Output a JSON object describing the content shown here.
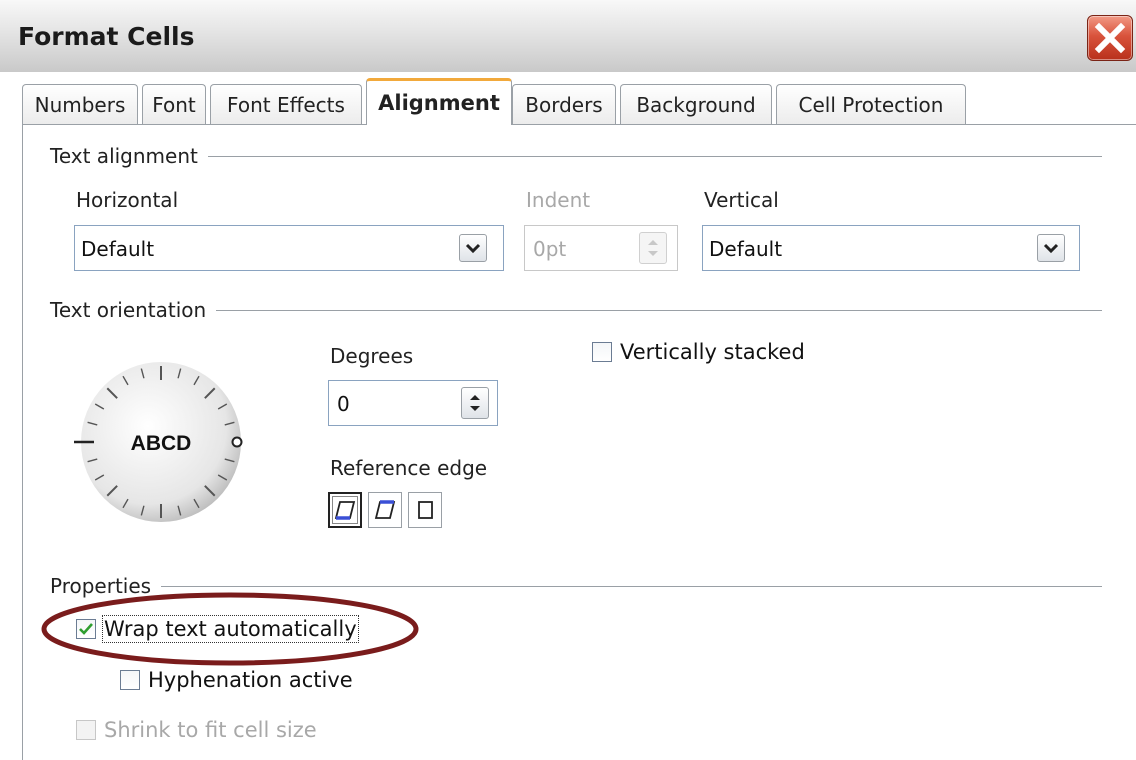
{
  "window": {
    "title": "Format Cells"
  },
  "tabs": [
    {
      "label": "Numbers"
    },
    {
      "label": "Font"
    },
    {
      "label": "Font Effects"
    },
    {
      "label": "Alignment"
    },
    {
      "label": "Borders"
    },
    {
      "label": "Background"
    },
    {
      "label": "Cell Protection"
    }
  ],
  "text_alignment": {
    "section_label": "Text alignment",
    "horizontal": {
      "label": "Horizontal",
      "value": "Default"
    },
    "indent": {
      "label": "Indent",
      "value": "0pt"
    },
    "vertical": {
      "label": "Vertical",
      "value": "Default"
    }
  },
  "text_orientation": {
    "section_label": "Text orientation",
    "dial_text": "ABCD",
    "degrees": {
      "label": "Degrees",
      "value": "0"
    },
    "reference_edge": {
      "label": "Reference edge",
      "selected_index": 0
    },
    "vertically_stacked": {
      "label": "Vertically stacked",
      "checked": false
    }
  },
  "properties": {
    "section_label": "Properties",
    "wrap_text": {
      "label": "Wrap text automatically",
      "checked": true
    },
    "hyphenation": {
      "label": "Hyphenation active",
      "checked": false
    },
    "shrink_to_fit": {
      "label": "Shrink to fit cell size",
      "checked": false,
      "disabled": true
    }
  },
  "colors": {
    "highlight_ellipse": "#7a1c1c",
    "checkmark": "#2f9e2f",
    "active_tab_accent": "#f2a93b",
    "close_button": "#d9533c"
  },
  "icons": {
    "close": "close-x-icon",
    "dropdown": "chevron-down-icon",
    "spin": "spin-up-down-icon",
    "checkmark": "checkmark-icon"
  }
}
